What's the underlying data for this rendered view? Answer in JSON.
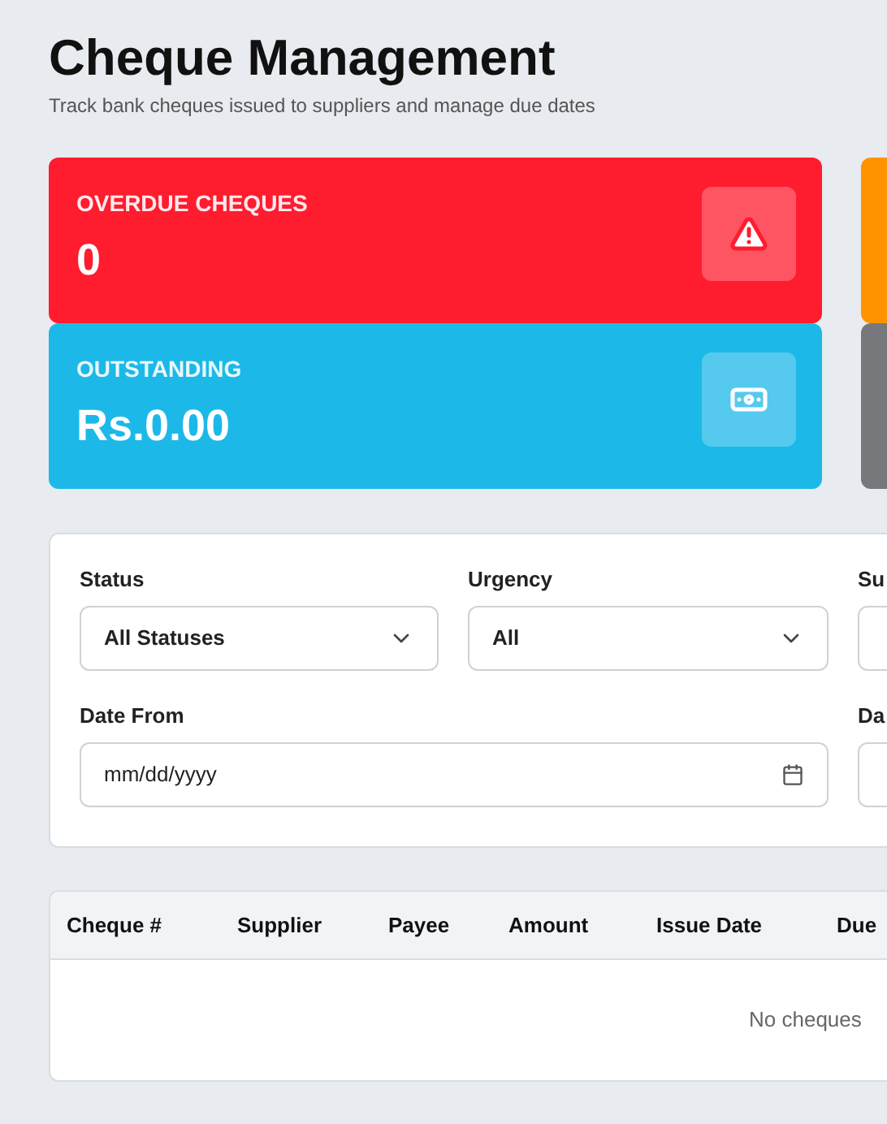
{
  "header": {
    "title": "Cheque Management",
    "subtitle": "Track bank cheques issued to suppliers and manage due dates"
  },
  "stat_cards": [
    {
      "label": "OVERDUE CHEQUES",
      "value": "0",
      "color": "#ff1c2f",
      "kind": "warning"
    },
    {
      "label": "OUTSTANDING",
      "value": "Rs.0.00",
      "color": "#1cb9e8",
      "kind": "money"
    },
    {
      "color": "#ff9300"
    },
    {
      "color": "#77787b"
    }
  ],
  "filters": [
    {
      "kind": "select",
      "label": "Status",
      "value": "All Statuses"
    },
    {
      "kind": "select",
      "label": "Urgency",
      "value": "All"
    },
    {
      "kind": "select",
      "label": "Su"
    },
    {
      "kind": "date",
      "label": "Date From",
      "placeholder": "mm/dd/yyyy"
    },
    {
      "kind": "date",
      "label": "Da"
    }
  ],
  "table": {
    "columns": [
      "Cheque #",
      "Supplier",
      "Payee",
      "Amount",
      "Issue Date",
      "Due"
    ],
    "empty_message": "No cheques"
  }
}
